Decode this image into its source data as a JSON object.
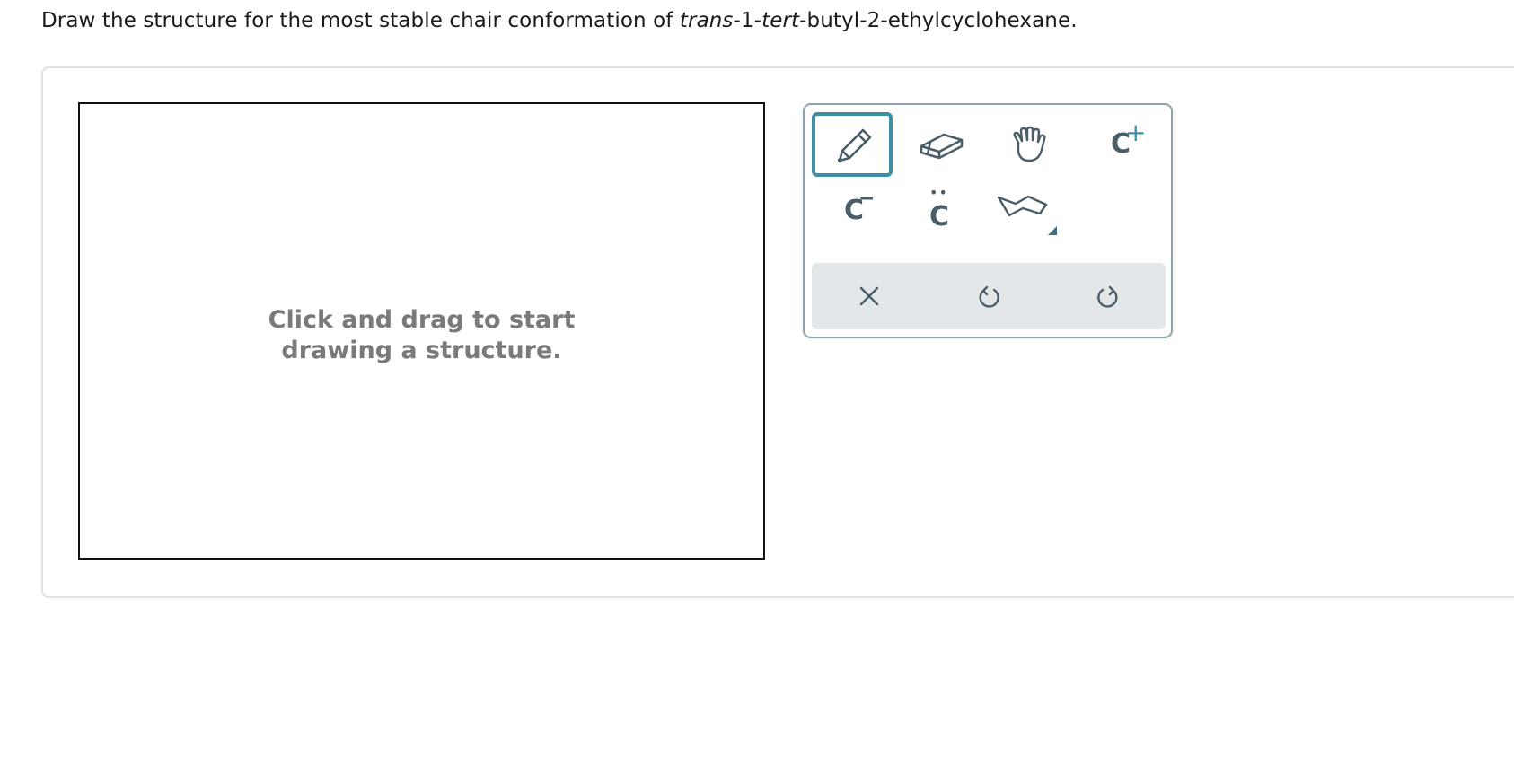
{
  "question": {
    "prefix": "Draw the structure for the most stable chair conformation of ",
    "italic1": "trans",
    "middle": "-1-",
    "italic2": "tert",
    "suffix": "-butyl-2-ethylcyclohexane."
  },
  "canvas": {
    "hint_line1": "Click and drag to start",
    "hint_line2": "drawing a structure."
  },
  "toolbar": {
    "tools": [
      {
        "name": "pencil",
        "icon": "pencil-icon",
        "selected": true
      },
      {
        "name": "eraser",
        "icon": "eraser-icon"
      },
      {
        "name": "move",
        "icon": "hand-icon"
      },
      {
        "name": "carbocation",
        "label": "C",
        "superscript": "+"
      },
      {
        "name": "carbanion",
        "label": "C",
        "superscript": "−"
      },
      {
        "name": "carbene",
        "label": "C",
        "dots": "••"
      },
      {
        "name": "chair-template",
        "icon": "cyclohexane-chair-icon"
      }
    ],
    "actions": [
      {
        "name": "clear",
        "icon": "x-icon"
      },
      {
        "name": "undo",
        "icon": "undo-icon"
      },
      {
        "name": "redo",
        "icon": "redo-icon"
      }
    ]
  },
  "colors": {
    "accent": "#3f8ea8",
    "icon": "#4a5e68",
    "plus": "#3f8ea8",
    "hint": "#7a7a7a",
    "panel_border": "#dde2e5",
    "action_bar": "#e3e7ea"
  }
}
